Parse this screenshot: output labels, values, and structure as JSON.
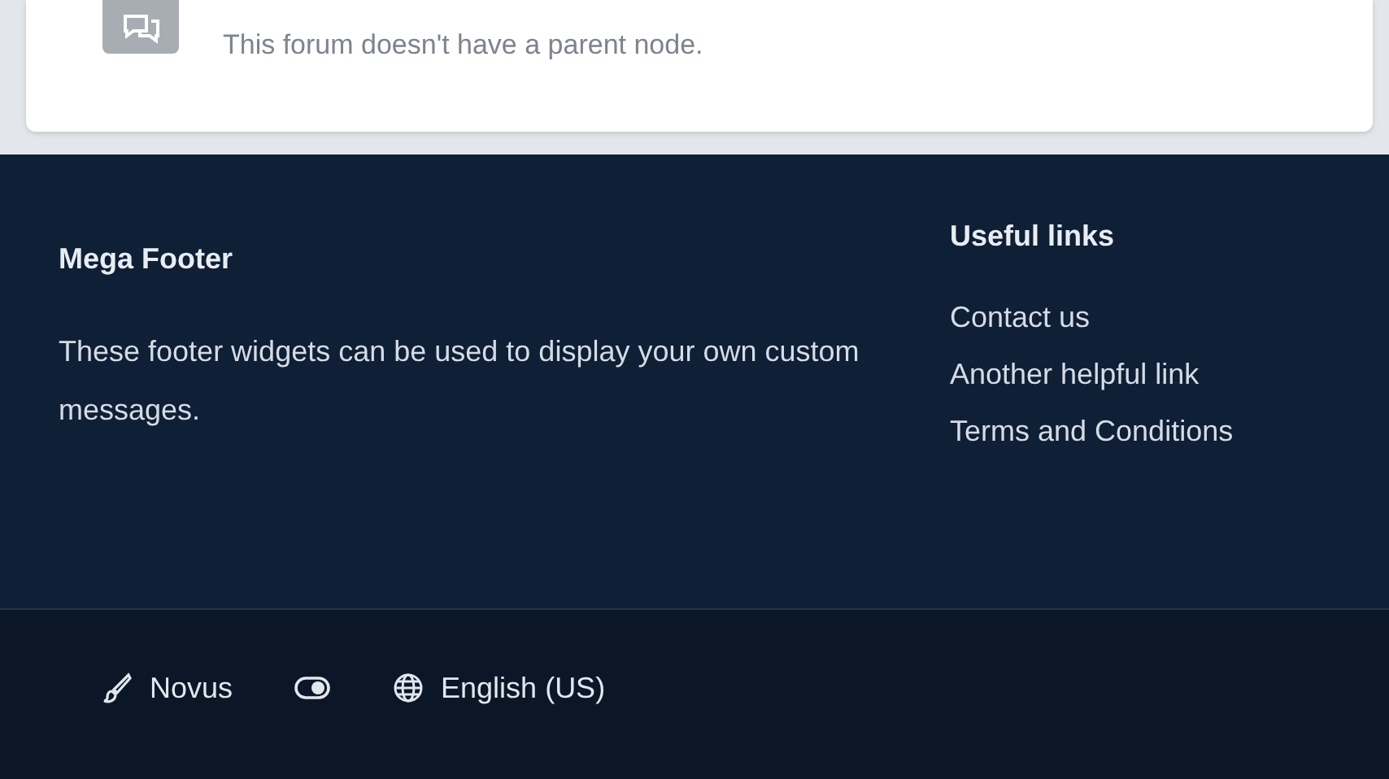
{
  "node_notice": {
    "text": "This forum doesn't have a parent node."
  },
  "footer": {
    "widgets": [
      {
        "kind": "text",
        "title": "Mega Footer",
        "text": "These footer widgets can be used to display your own custom messages."
      },
      {
        "kind": "links",
        "title": "Useful links",
        "links": [
          "Contact us",
          "Another helpful link",
          "Terms and Conditions"
        ]
      }
    ]
  },
  "bottom_bar": {
    "style": "Novus",
    "language": "English (US)"
  }
}
